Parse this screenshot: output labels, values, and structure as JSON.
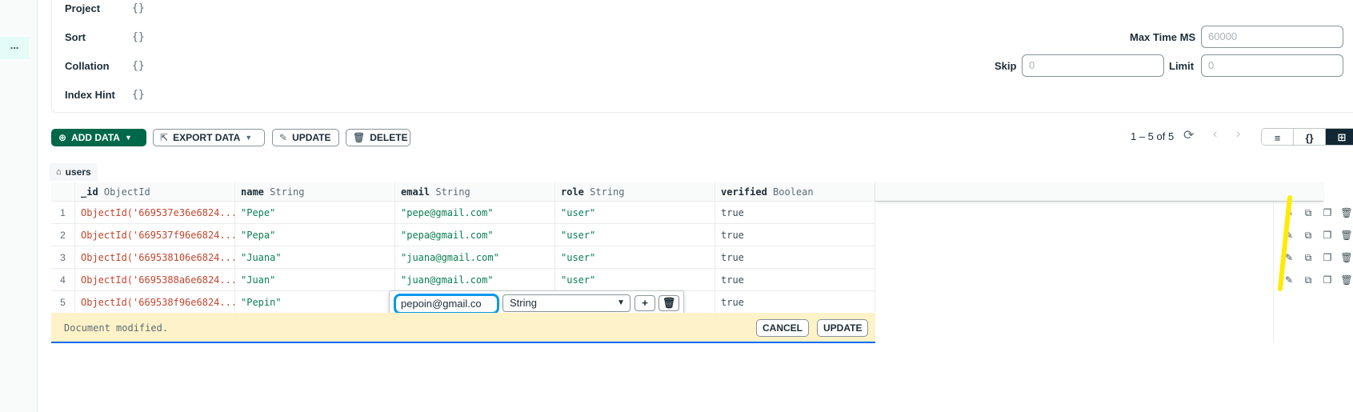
{
  "sidebar": {
    "more_label": "..."
  },
  "query_options": {
    "project": {
      "label": "Project",
      "value": "{}"
    },
    "sort": {
      "label": "Sort",
      "value": "{}"
    },
    "collation": {
      "label": "Collation",
      "value": "{}"
    },
    "index_hint": {
      "label": "Index Hint",
      "value": "{}"
    },
    "max_time_ms": {
      "label": "Max Time MS",
      "placeholder": "60000"
    },
    "skip": {
      "label": "Skip",
      "placeholder": "0"
    },
    "limit": {
      "label": "Limit",
      "placeholder": "0"
    }
  },
  "toolbar": {
    "add_data": "ADD DATA",
    "export_data": "EXPORT DATA",
    "update": "UPDATE",
    "delete": "DELETE",
    "pagination": "1 – 5 of 5"
  },
  "view_buttons": {
    "list": "≡",
    "json": "{}",
    "table": "⊞"
  },
  "breadcrumb": {
    "collection": "users"
  },
  "columns": [
    {
      "name": "_id",
      "type": "ObjectId"
    },
    {
      "name": "name",
      "type": "String"
    },
    {
      "name": "email",
      "type": "String"
    },
    {
      "name": "role",
      "type": "String"
    },
    {
      "name": "verified",
      "type": "Boolean"
    }
  ],
  "rows": [
    {
      "num": "1",
      "id": "ObjectId('669537e36e6824...",
      "name": "\"Pepe\"",
      "email": "\"pepe@gmail.com\"",
      "role": "\"user\"",
      "verified": "true"
    },
    {
      "num": "2",
      "id": "ObjectId('669537f96e6824...",
      "name": "\"Pepa\"",
      "email": "\"pepa@gmail.com\"",
      "role": "\"user\"",
      "verified": "true"
    },
    {
      "num": "3",
      "id": "ObjectId('669538106e6824...",
      "name": "\"Juana\"",
      "email": "\"juana@gmail.com\"",
      "role": "\"user\"",
      "verified": "true"
    },
    {
      "num": "4",
      "id": "ObjectId('6695388a6e6824...",
      "name": "\"Juan\"",
      "email": "\"juan@gmail.com\"",
      "role": "\"user\"",
      "verified": "true"
    },
    {
      "num": "5",
      "id": "ObjectId('669538f96e6824...",
      "name": "\"Pepin\"",
      "email": "",
      "role": "",
      "verified": "true"
    }
  ],
  "editor": {
    "value": "pepoin@gmail.co",
    "type": "String",
    "add_symbol": "+",
    "remove_icon": "trash-icon"
  },
  "modified_bar": {
    "message": "Document modified.",
    "cancel": "CANCEL",
    "update": "UPDATE"
  },
  "colors": {
    "primary": "#00684a",
    "objectid": "#c2462e",
    "string": "#0a7f54",
    "highlight": "#ffeb00",
    "focus": "#0498ec"
  }
}
